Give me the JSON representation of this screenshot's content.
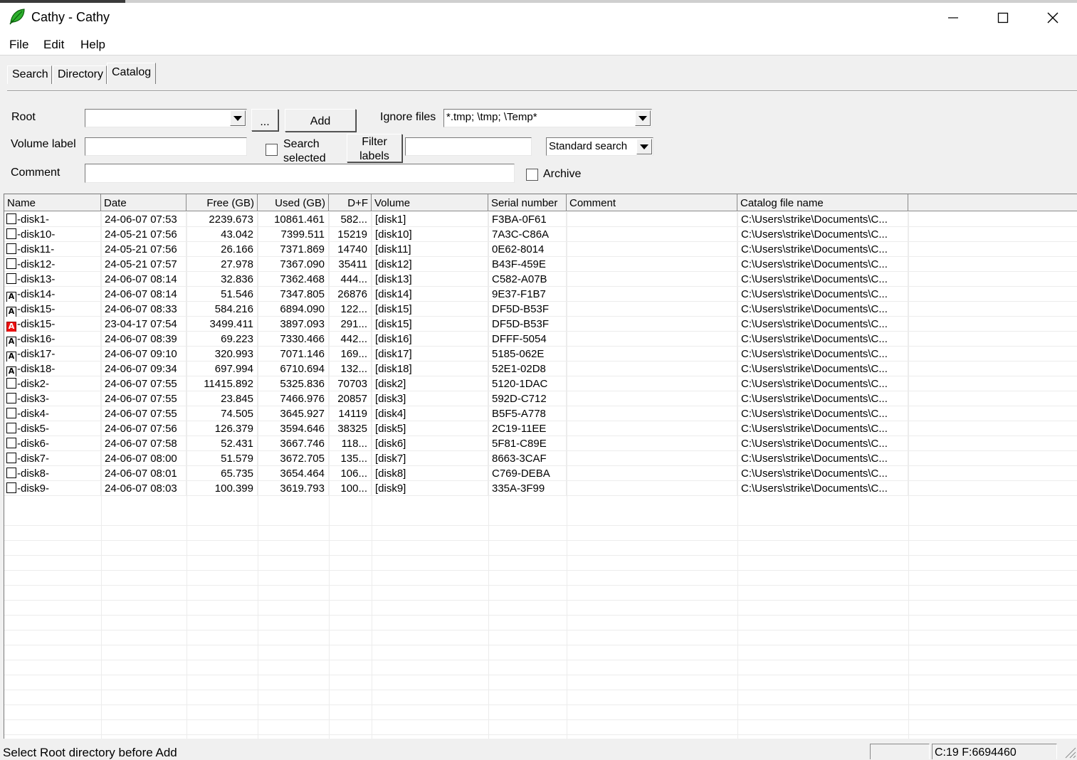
{
  "window": {
    "title": "Cathy - Cathy"
  },
  "menu": {
    "file": "File",
    "edit": "Edit",
    "help": "Help"
  },
  "tabs": [
    "Search",
    "Directory",
    "Catalog"
  ],
  "form": {
    "root_label": "Root",
    "root_value": "",
    "browse_label": "...",
    "add_label": "Add",
    "ignore_label": "Ignore files",
    "ignore_value": "*.tmp; \\tmp; \\Temp*",
    "volume_label": "Volume label",
    "volume_value": "",
    "search_selected_line1": "Search",
    "search_selected_line2": "selected",
    "filter_line1": "Filter",
    "filter_line2": "labels",
    "filter_value": "",
    "search_mode": "Standard search",
    "comment_label": "Comment",
    "comment_value": "",
    "archive_label": "Archive"
  },
  "table": {
    "columns": [
      "Name",
      "Date",
      "Free (GB)",
      "Used (GB)",
      "D+F",
      "Volume",
      "Serial number",
      "Comment",
      "Catalog file name"
    ],
    "rows": [
      {
        "icon": "box",
        "name": "-disk1-",
        "date": "24-06-07 07:53",
        "free": "2239.673",
        "used": "10861.461",
        "df": "582...",
        "volume": "[disk1]",
        "serial": "F3BA-0F61",
        "comment": "",
        "file": "C:\\Users\\strike\\Documents\\C..."
      },
      {
        "icon": "box",
        "name": "-disk10-",
        "date": "24-05-21 07:56",
        "free": "43.042",
        "used": "7399.511",
        "df": "15219",
        "volume": "[disk10]",
        "serial": "7A3C-C86A",
        "comment": "",
        "file": "C:\\Users\\strike\\Documents\\C..."
      },
      {
        "icon": "box",
        "name": "-disk11-",
        "date": "24-05-21 07:56",
        "free": "26.166",
        "used": "7371.869",
        "df": "14740",
        "volume": "[disk11]",
        "serial": "0E62-8014",
        "comment": "",
        "file": "C:\\Users\\strike\\Documents\\C..."
      },
      {
        "icon": "box",
        "name": "-disk12-",
        "date": "24-05-21 07:57",
        "free": "27.978",
        "used": "7367.090",
        "df": "35411",
        "volume": "[disk12]",
        "serial": "B43F-459E",
        "comment": "",
        "file": "C:\\Users\\strike\\Documents\\C..."
      },
      {
        "icon": "box",
        "name": "-disk13-",
        "date": "24-06-07 08:14",
        "free": "32.836",
        "used": "7362.468",
        "df": "444...",
        "volume": "[disk13]",
        "serial": "C582-A07B",
        "comment": "",
        "file": "C:\\Users\\strike\\Documents\\C..."
      },
      {
        "icon": "archive",
        "name": "-disk14-",
        "date": "24-06-07 08:14",
        "free": "51.546",
        "used": "7347.805",
        "df": "26876",
        "volume": "[disk14]",
        "serial": "9E37-F1B7",
        "comment": "",
        "file": "C:\\Users\\strike\\Documents\\C..."
      },
      {
        "icon": "archive",
        "name": "-disk15-",
        "date": "24-06-07 08:33",
        "free": "584.216",
        "used": "6894.090",
        "df": "122...",
        "volume": "[disk15]",
        "serial": "DF5D-B53F",
        "comment": "",
        "file": "C:\\Users\\strike\\Documents\\C..."
      },
      {
        "icon": "archive-red",
        "name": "-disk15-",
        "date": "23-04-17 07:54",
        "free": "3499.411",
        "used": "3897.093",
        "df": "291...",
        "volume": "[disk15]",
        "serial": "DF5D-B53F",
        "comment": "",
        "file": "C:\\Users\\strike\\Documents\\C..."
      },
      {
        "icon": "archive",
        "name": "-disk16-",
        "date": "24-06-07 08:39",
        "free": "69.223",
        "used": "7330.466",
        "df": "442...",
        "volume": "[disk16]",
        "serial": "DFFF-5054",
        "comment": "",
        "file": "C:\\Users\\strike\\Documents\\C..."
      },
      {
        "icon": "archive",
        "name": "-disk17-",
        "date": "24-06-07 09:10",
        "free": "320.993",
        "used": "7071.146",
        "df": "169...",
        "volume": "[disk17]",
        "serial": "5185-062E",
        "comment": "",
        "file": "C:\\Users\\strike\\Documents\\C..."
      },
      {
        "icon": "archive",
        "name": "-disk18-",
        "date": "24-06-07 09:34",
        "free": "697.994",
        "used": "6710.694",
        "df": "132...",
        "volume": "[disk18]",
        "serial": "52E1-02D8",
        "comment": "",
        "file": "C:\\Users\\strike\\Documents\\C..."
      },
      {
        "icon": "box",
        "name": "-disk2-",
        "date": "24-06-07 07:55",
        "free": "11415.892",
        "used": "5325.836",
        "df": "70703",
        "volume": "[disk2]",
        "serial": "5120-1DAC",
        "comment": "",
        "file": "C:\\Users\\strike\\Documents\\C..."
      },
      {
        "icon": "box",
        "name": "-disk3-",
        "date": "24-06-07 07:55",
        "free": "23.845",
        "used": "7466.976",
        "df": "20857",
        "volume": "[disk3]",
        "serial": "592D-C712",
        "comment": "",
        "file": "C:\\Users\\strike\\Documents\\C..."
      },
      {
        "icon": "box",
        "name": "-disk4-",
        "date": "24-06-07 07:55",
        "free": "74.505",
        "used": "3645.927",
        "df": "14119",
        "volume": "[disk4]",
        "serial": "B5F5-A778",
        "comment": "",
        "file": "C:\\Users\\strike\\Documents\\C..."
      },
      {
        "icon": "box",
        "name": "-disk5-",
        "date": "24-06-07 07:56",
        "free": "126.379",
        "used": "3594.646",
        "df": "38325",
        "volume": "[disk5]",
        "serial": "2C19-11EE",
        "comment": "",
        "file": "C:\\Users\\strike\\Documents\\C..."
      },
      {
        "icon": "box",
        "name": "-disk6-",
        "date": "24-06-07 07:58",
        "free": "52.431",
        "used": "3667.746",
        "df": "118...",
        "volume": "[disk6]",
        "serial": "5F81-C89E",
        "comment": "",
        "file": "C:\\Users\\strike\\Documents\\C..."
      },
      {
        "icon": "box",
        "name": "-disk7-",
        "date": "24-06-07 08:00",
        "free": "51.579",
        "used": "3672.705",
        "df": "135...",
        "volume": "[disk7]",
        "serial": "8663-3CAF",
        "comment": "",
        "file": "C:\\Users\\strike\\Documents\\C..."
      },
      {
        "icon": "box",
        "name": "-disk8-",
        "date": "24-06-07 08:01",
        "free": "65.735",
        "used": "3654.464",
        "df": "106...",
        "volume": "[disk8]",
        "serial": "C769-DEBA",
        "comment": "",
        "file": "C:\\Users\\strike\\Documents\\C..."
      },
      {
        "icon": "box",
        "name": "-disk9-",
        "date": "24-06-07 08:03",
        "free": "100.399",
        "used": "3619.793",
        "df": "100...",
        "volume": "[disk9]",
        "serial": "335A-3F99",
        "comment": "",
        "file": "C:\\Users\\strike\\Documents\\C..."
      }
    ]
  },
  "status": {
    "message": "Select Root directory before Add",
    "panel1": "",
    "panel2": "C:19 F:6694460"
  }
}
